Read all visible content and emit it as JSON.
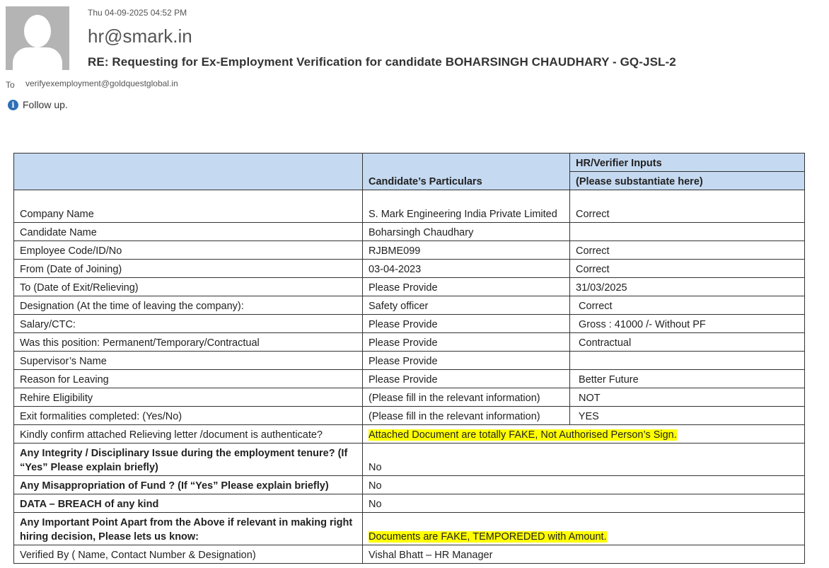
{
  "email": {
    "date": "Thu 04-09-2025 04:52 PM",
    "from": "hr@smark.in",
    "subject": "RE: Requesting for Ex-Employment Verification for candidate BOHARSINGH CHAUDHARY - GQ-JSL-2",
    "to_label": "To",
    "to": "verifyexemployment@goldquestglobal.in",
    "info": "Follow up."
  },
  "table": {
    "header": {
      "col2": "Candidate’s Particulars",
      "col3_top": "HR/Verifier Inputs",
      "col3_bottom": "(Please substantiate here)"
    },
    "rows": [
      {
        "label": "Company Name",
        "particular": "S. Mark Engineering India Private Limited",
        "input": "Correct"
      },
      {
        "label": "Candidate Name",
        "particular": "Boharsingh Chaudhary",
        "input": ""
      },
      {
        "label": "Employee Code/ID/No",
        "particular": "RJBME099",
        "input": "Correct"
      },
      {
        "label": "From (Date of Joining)",
        "particular": "03-04-2023",
        "input": "Correct"
      },
      {
        "label": "To (Date of Exit/Relieving)",
        "particular": "Please Provide",
        "input": "31/03/2025"
      },
      {
        "label": "Designation (At the time of leaving the company):",
        "particular": "Safety officer",
        "input": " Correct"
      },
      {
        "label": "Salary/CTC:",
        "particular": "Please Provide",
        "input": " Gross : 41000 /- Without PF"
      },
      {
        "label": "Was this position: Permanent/Temporary/Contractual",
        "particular": "Please Provide",
        "input": " Contractual"
      },
      {
        "label": "Supervisor’s Name",
        "particular": "Please Provide",
        "input": ""
      },
      {
        "label": "Reason for Leaving",
        "particular": "Please Provide",
        "input": " Better Future"
      },
      {
        "label": "Rehire Eligibility",
        "particular": "(Please fill in the relevant information)",
        "input": " NOT"
      },
      {
        "label": "Exit formalities completed: (Yes/No)",
        "particular": "(Please fill in the relevant information)",
        "input": " YES"
      },
      {
        "label": "Kindly confirm attached Relieving letter /document is authenticate?",
        "merged": "Attached Document are totally FAKE,  Not Authorised Person’s Sign."
      },
      {
        "label": "Any Integrity / Disciplinary Issue during the employment tenure? (If “Yes” Please explain briefly)",
        "merged": "No"
      },
      {
        "label": "Any Misappropriation of Fund ? (If “Yes” Please explain briefly)",
        "merged": "No"
      },
      {
        "label": "DATA – BREACH of any kind",
        "merged": "No"
      },
      {
        "label": "Any Important Point Apart from the Above if relevant in making right hiring decision, Please lets us know:",
        "merged": "Documents are FAKE, TEMPOREDED with Amount."
      },
      {
        "label": "Verified By ( Name, Contact Number & Designation)",
        "merged": "Vishal Bhatt – HR Manager"
      }
    ]
  }
}
